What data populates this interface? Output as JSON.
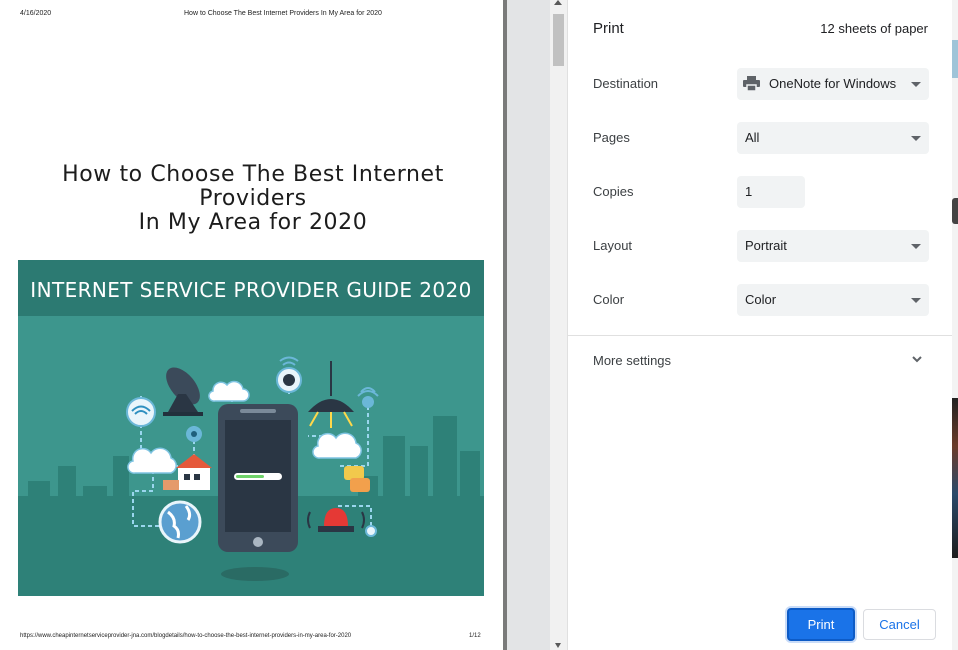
{
  "preview": {
    "header_date": "4/16/2020",
    "header_title": "How to Choose The Best Internet Providers In My Area for 2020",
    "doc_title_line1": "How to Choose The Best Internet Providers",
    "doc_title_line2": "In My Area for 2020",
    "hero_caption": "INTERNET SERVICE PROVIDER GUIDE 2020",
    "footer_url": "https://www.cheapinternetserviceprovider-jna.com/blogdetails/how-to-choose-the-best-internet-providers-in-my-area-for-2020",
    "footer_page": "1/12"
  },
  "panel": {
    "title": "Print",
    "sheets": "12 sheets of paper",
    "destination": {
      "label": "Destination",
      "value": "OneNote for Windows",
      "icon": "printer-icon"
    },
    "pages": {
      "label": "Pages",
      "value": "All"
    },
    "copies": {
      "label": "Copies",
      "value": "1"
    },
    "layout": {
      "label": "Layout",
      "value": "Portrait"
    },
    "color": {
      "label": "Color",
      "value": "Color"
    },
    "more_settings": "More settings",
    "print_button": "Print",
    "cancel_button": "Cancel"
  },
  "colors": {
    "accent": "#1a73e8",
    "hero_bg": "#3d968d",
    "hero_band": "#2c7a72"
  }
}
